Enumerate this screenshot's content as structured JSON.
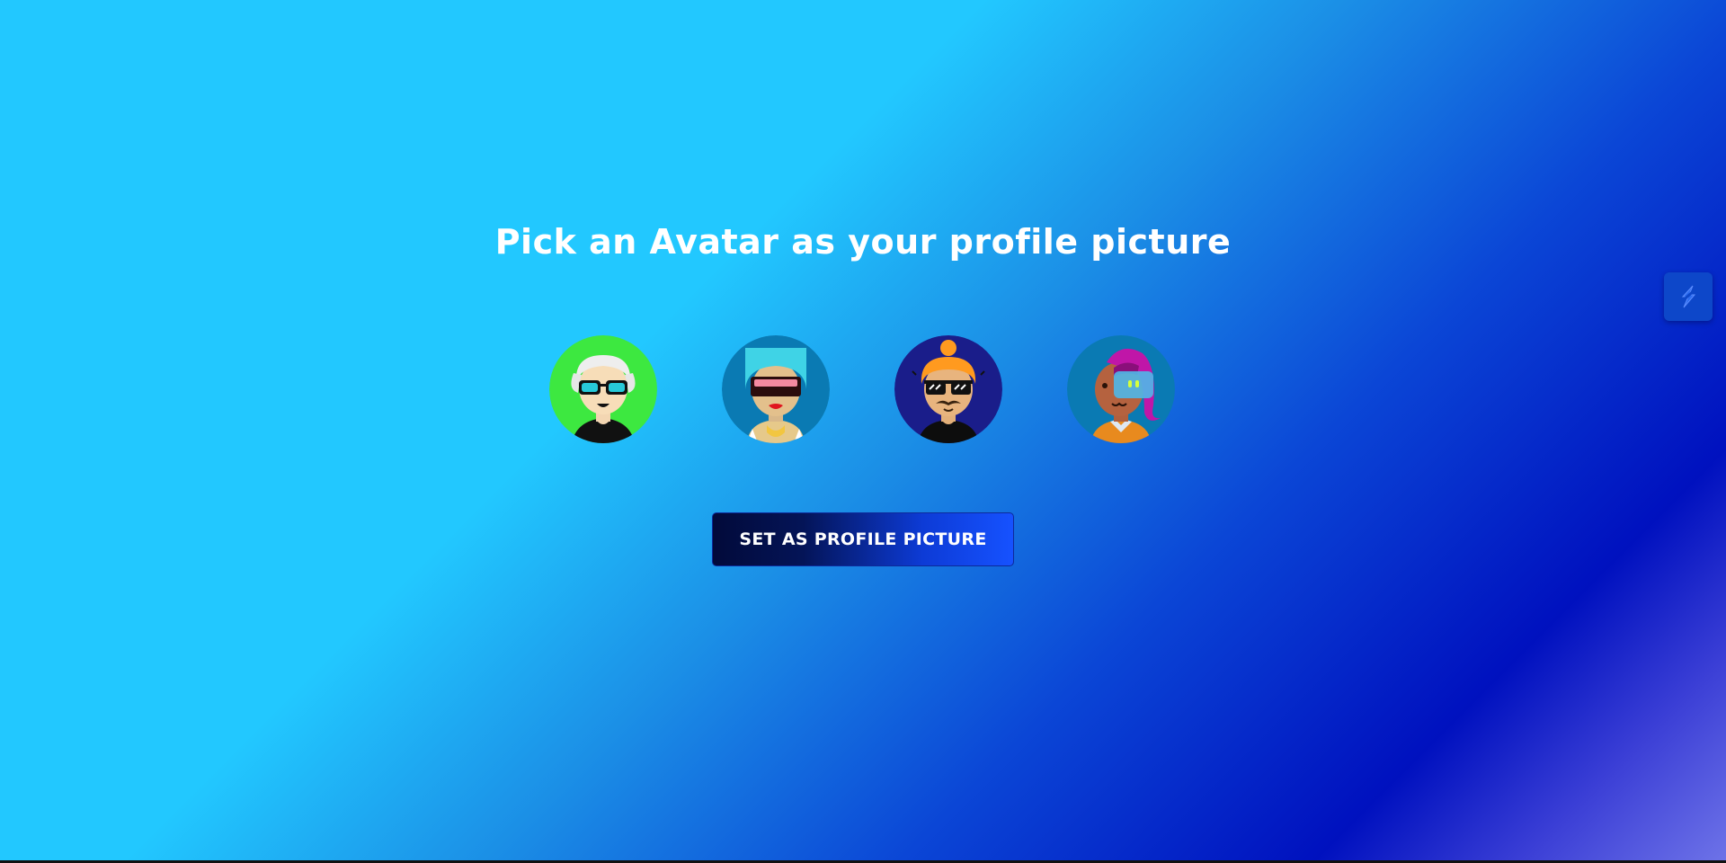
{
  "page": {
    "title": "Pick an Avatar as your profile picture"
  },
  "avatars": [
    {
      "name": "avatar-green-bg",
      "background": "#3de840"
    },
    {
      "name": "avatar-teal-bg",
      "background": "#0a7ab3"
    },
    {
      "name": "avatar-navy-bg",
      "background": "#1a1d8a"
    },
    {
      "name": "avatar-blue-bg",
      "background": "#0a7ab3"
    }
  ],
  "actions": {
    "set_profile_label": "SET AS PROFILE PICTURE"
  },
  "widget": {
    "icon": "lightning-icon"
  },
  "colors": {
    "title": "#ffffff",
    "button_dark": "#020a3a",
    "button_light": "#1652ff"
  }
}
